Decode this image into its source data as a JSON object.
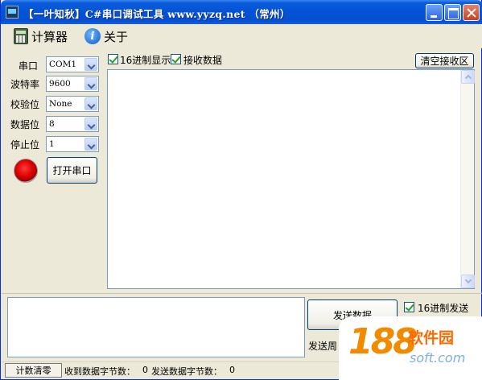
{
  "window": {
    "title": "【一叶知秋】C#串口调试工具   www.yyzq.net   （常州）"
  },
  "menu": {
    "items": [
      {
        "label": "计算器",
        "icon": "calculator-icon"
      },
      {
        "label": "关于",
        "icon": "info-icon"
      }
    ]
  },
  "settings": {
    "port_label": "串口",
    "port_value": "COM1",
    "baud_label": "波特率",
    "baud_value": "9600",
    "parity_label": "校验位",
    "parity_value": "None",
    "databits_label": "数据位",
    "databits_value": "8",
    "stopbits_label": "停止位",
    "stopbits_value": "1",
    "open_button": "打开串口",
    "status_led_color": "#dd0000"
  },
  "receive": {
    "hex_display_label": "16进制显示",
    "hex_display_checked": true,
    "receive_data_label": "接收数据",
    "receive_data_checked": true,
    "clear_button": "清空接收区",
    "content": ""
  },
  "send": {
    "content": "",
    "send_button": "发送数据",
    "hex_send_label": "16进制发送",
    "hex_send_checked": true,
    "period_label": "发送周"
  },
  "statusbar": {
    "reset_button": "计数清零",
    "received_label": "收到数据字节数：",
    "received_count": "0",
    "sent_label": "发送数据字节数：",
    "sent_count": "0"
  },
  "watermark": {
    "logo": "188",
    "name": "软件园",
    "url": "soft.com"
  },
  "colors": {
    "titlebar": "#0452d6",
    "window_bg": "#ECE9D8",
    "accent": "#0831D9"
  }
}
